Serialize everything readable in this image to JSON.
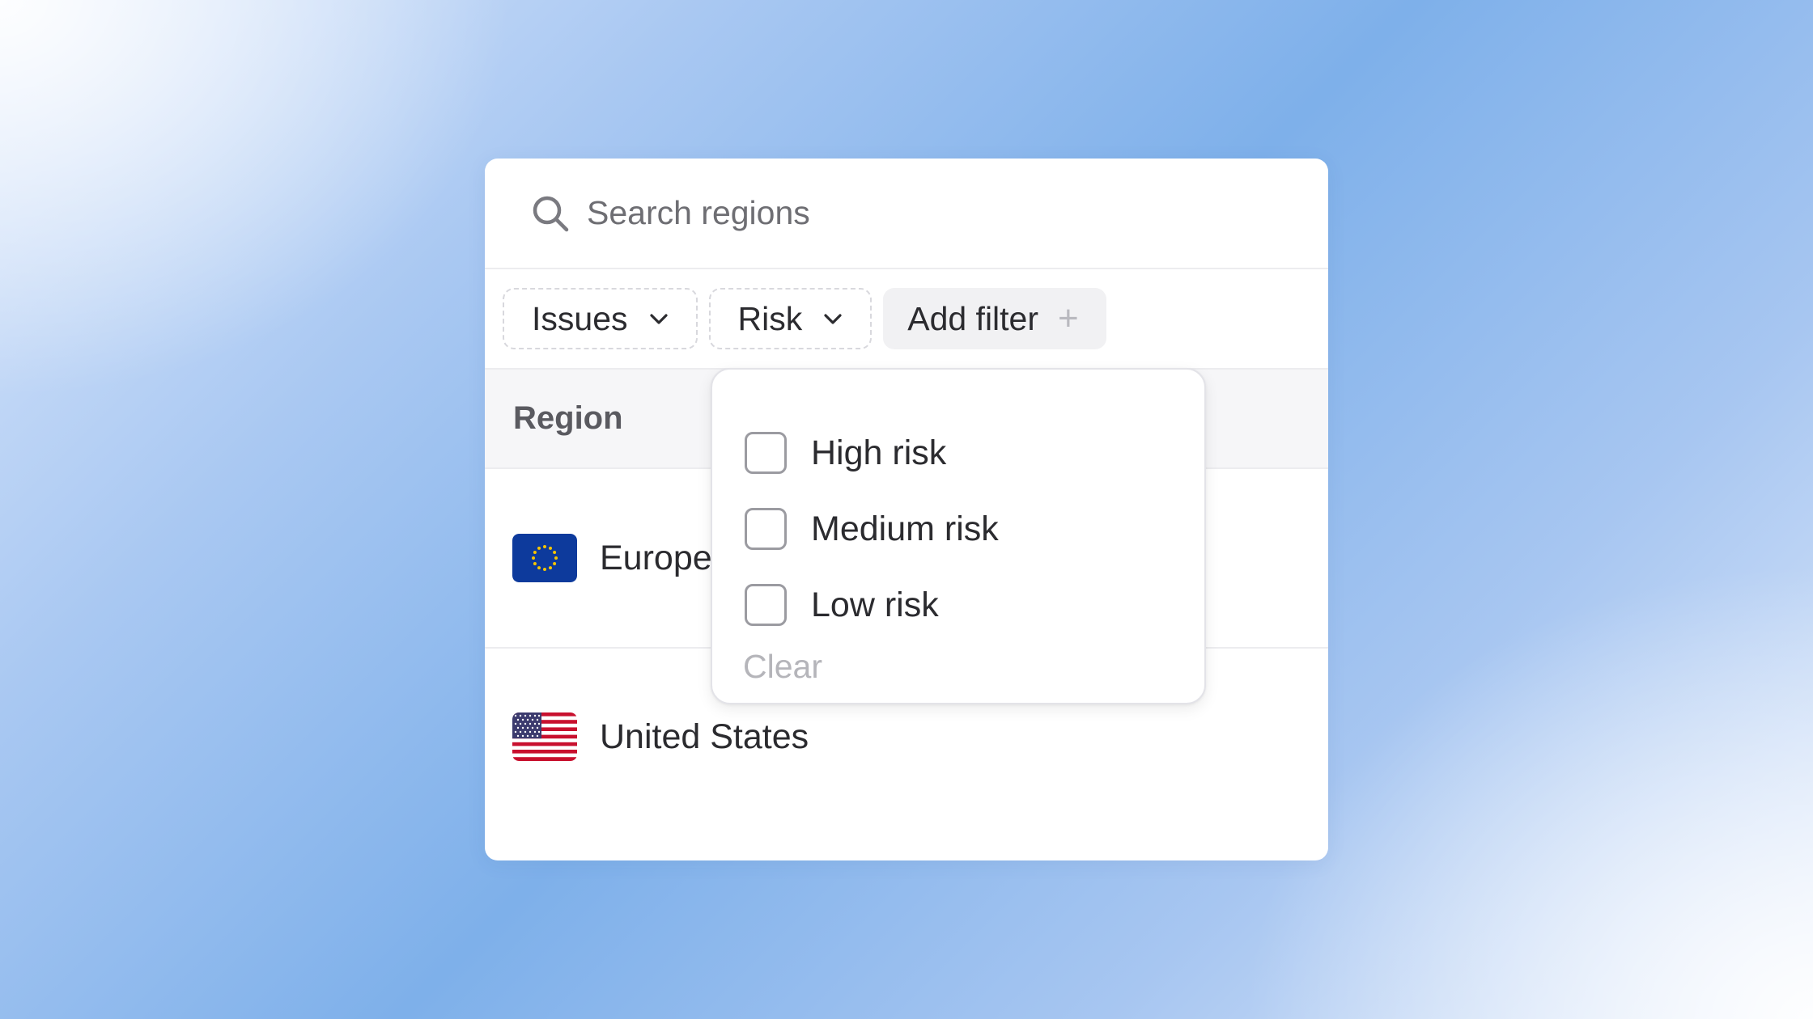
{
  "search": {
    "placeholder": "Search regions"
  },
  "filters": {
    "chips": [
      {
        "label": "Issues"
      },
      {
        "label": "Risk"
      }
    ],
    "add_label": "Add filter",
    "add_icon": "+"
  },
  "table": {
    "header": "Region",
    "rows": [
      {
        "label": "Europe",
        "flag": "eu-flag-icon"
      },
      {
        "label": "United States",
        "flag": "us-flag-icon"
      }
    ]
  },
  "dropdown": {
    "options": [
      {
        "label": "High risk",
        "checked": false
      },
      {
        "label": "Medium risk",
        "checked": false
      },
      {
        "label": "Low risk",
        "checked": false
      }
    ],
    "clear_label": "Clear"
  },
  "colors": {
    "eu_blue": "#0d3a9c",
    "eu_stars": "#f5c400",
    "us_red": "#c8102e",
    "us_blue": "#3c3b6e"
  }
}
